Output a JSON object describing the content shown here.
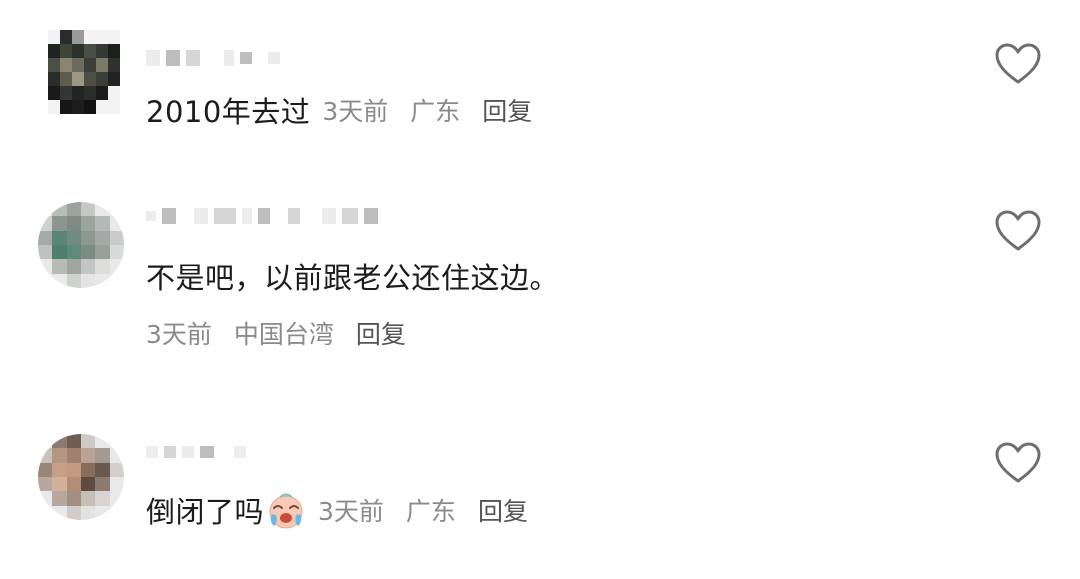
{
  "colors": {
    "text_primary": "#1c1c1c",
    "text_secondary": "#8b8b8b",
    "reply": "#555555",
    "heart_outline": "#6e6e6e"
  },
  "comments": [
    {
      "text": "2010年去过",
      "time": "3天前",
      "location": "广东",
      "reply": "回复",
      "layout": "inline",
      "like_icon": "heart-outline-icon"
    },
    {
      "text": "不是吧，以前跟老公还住这边。",
      "time": "3天前",
      "location": "中国台湾",
      "reply": "回复",
      "layout": "stacked",
      "like_icon": "heart-outline-icon"
    },
    {
      "text": "倒闭了吗",
      "emoji": "crying-emoji",
      "time": "3天前",
      "location": "广东",
      "reply": "回复",
      "layout": "inline",
      "like_icon": "heart-outline-icon"
    }
  ]
}
